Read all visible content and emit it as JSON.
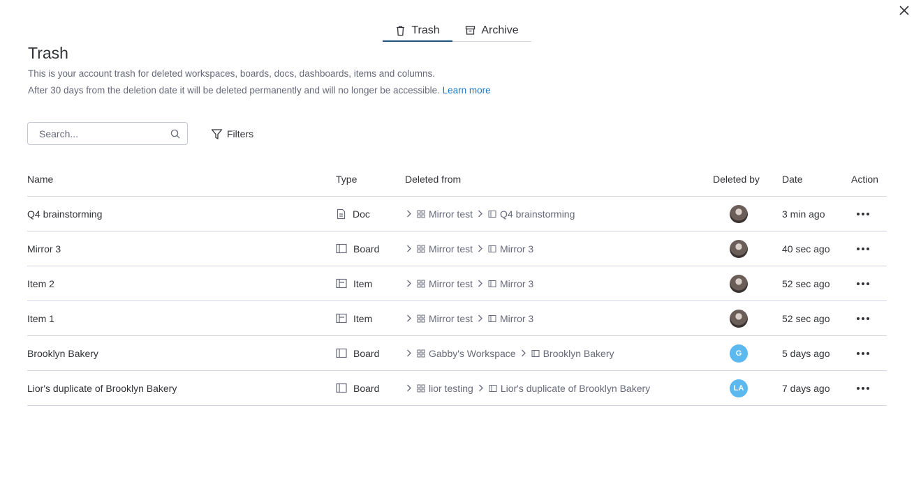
{
  "tabs": [
    {
      "label": "Trash",
      "icon": "trash-icon",
      "active": true
    },
    {
      "label": "Archive",
      "icon": "archive-icon",
      "active": false
    }
  ],
  "header": {
    "title": "Trash",
    "description_line1": "This is your account trash for deleted workspaces, boards, docs, dashboards, items and columns.",
    "description_line2": "After 30 days from the deletion date it will be deleted permanently and will no longer be accessible.",
    "learn_more": "Learn more"
  },
  "search": {
    "placeholder": "Search...",
    "value": ""
  },
  "filters_label": "Filters",
  "columns": {
    "name": "Name",
    "type": "Type",
    "deleted_from": "Deleted from",
    "deleted_by": "Deleted by",
    "date": "Date",
    "action": "Action"
  },
  "rows": [
    {
      "name": "Q4 brainstorming",
      "type": "Doc",
      "type_icon": "doc-icon",
      "workspace": "Mirror test",
      "board": "Q4 brainstorming",
      "deleted_by": "",
      "date": "3 min ago"
    },
    {
      "name": "Mirror 3",
      "type": "Board",
      "type_icon": "board-icon",
      "workspace": "Mirror test",
      "board": "Mirror 3",
      "deleted_by": "",
      "date": "40 sec ago"
    },
    {
      "name": "Item 2",
      "type": "Item",
      "type_icon": "item-icon",
      "workspace": "Mirror test",
      "board": "Mirror 3",
      "deleted_by": "",
      "date": "52 sec ago"
    },
    {
      "name": "Item 1",
      "type": "Item",
      "type_icon": "item-icon",
      "workspace": "Mirror test",
      "board": "Mirror 3",
      "deleted_by": "",
      "date": "52 sec ago"
    },
    {
      "name": "Brooklyn Bakery",
      "type": "Board",
      "type_icon": "board-icon",
      "workspace": "Gabby's Workspace",
      "board": "Brooklyn Bakery",
      "deleted_by": "G",
      "date": "5 days ago"
    },
    {
      "name": "Lior's duplicate of Brooklyn Bakery",
      "type": "Board",
      "type_icon": "board-icon",
      "workspace": "lior testing",
      "board": "Lior's duplicate of Brooklyn Bakery",
      "deleted_by": "LA",
      "date": "7 days ago"
    }
  ],
  "colors": {
    "accent": "#1f76c2",
    "tab_underline": "#1f4f7e",
    "avatar_blue": "#5cb9ef",
    "muted_text": "#676879"
  }
}
